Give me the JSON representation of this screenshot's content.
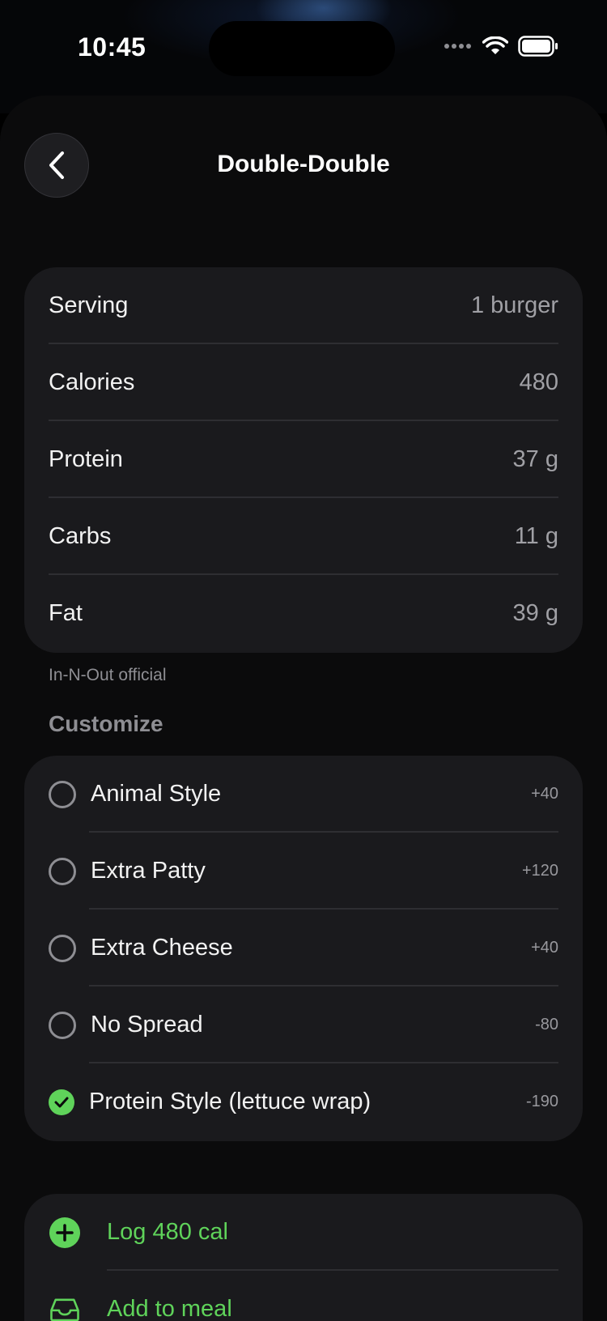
{
  "status_bar": {
    "time": "10:45"
  },
  "nav": {
    "title": "Double-Double",
    "back_icon": "chevron-left-icon"
  },
  "nutrition": {
    "rows": [
      {
        "label": "Serving",
        "value": "1 burger"
      },
      {
        "label": "Calories",
        "value": "480"
      },
      {
        "label": "Protein",
        "value": "37 g"
      },
      {
        "label": "Carbs",
        "value": "11 g"
      },
      {
        "label": "Fat",
        "value": "39 g"
      }
    ],
    "source": "In-N-Out official"
  },
  "customize": {
    "header": "Customize",
    "options": [
      {
        "label": "Animal Style",
        "delta": "+40",
        "checked": false
      },
      {
        "label": "Extra Patty",
        "delta": "+120",
        "checked": false
      },
      {
        "label": "Extra Cheese",
        "delta": "+40",
        "checked": false
      },
      {
        "label": "No Spread",
        "delta": "-80",
        "checked": false
      },
      {
        "label": "Protein Style (lettuce wrap)",
        "delta": "-190",
        "checked": true
      }
    ]
  },
  "actions": {
    "log_label": "Log 480 cal",
    "log_icon": "plus-circle-icon",
    "meal_label": "Add to meal",
    "meal_icon": "tray-icon"
  },
  "colors": {
    "accent": "#5fd35a",
    "card": "#1a1a1d",
    "secondary_text": "#8e8e93"
  }
}
